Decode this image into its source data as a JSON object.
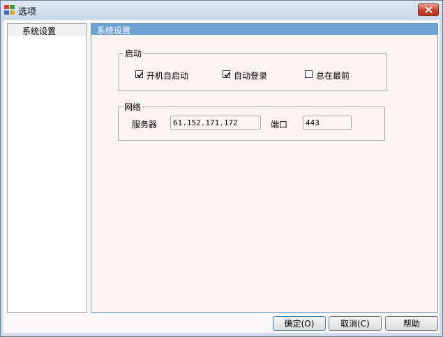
{
  "window": {
    "title": "选项"
  },
  "sidebar": {
    "items": [
      {
        "label": "系统设置",
        "selected": true
      }
    ]
  },
  "panel": {
    "title": "系统设置"
  },
  "startup": {
    "label": "启动",
    "options": [
      {
        "label": "开机自启动",
        "checked": true
      },
      {
        "label": "自动登录",
        "checked": true
      },
      {
        "label": "总在最前",
        "checked": false
      }
    ]
  },
  "network": {
    "label": "网络",
    "server_label": "服务器",
    "server_value": "61.152.171.172",
    "port_label": "端口",
    "port_value": "443"
  },
  "buttons": {
    "ok": "确定(O)",
    "cancel": "取消(C)",
    "help": "帮助"
  },
  "colors": {
    "panel_header": "#6ea2d1",
    "close_button": "#c9412c"
  }
}
